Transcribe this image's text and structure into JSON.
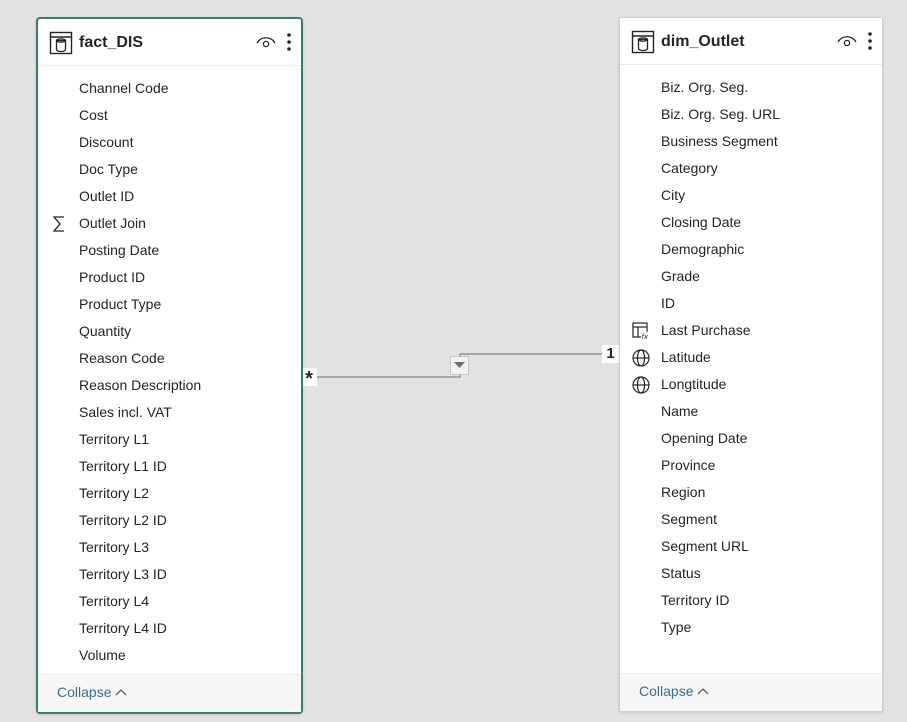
{
  "relationship": {
    "from_cardinality": "*",
    "to_cardinality": "1"
  },
  "fact_table": {
    "name": "fact_DIS",
    "collapse_label": "Collapse",
    "fields": [
      {
        "label": "Channel Code",
        "icon": ""
      },
      {
        "label": "Cost",
        "icon": ""
      },
      {
        "label": "Discount",
        "icon": ""
      },
      {
        "label": "Doc Type",
        "icon": ""
      },
      {
        "label": "Outlet ID",
        "icon": ""
      },
      {
        "label": "Outlet Join",
        "icon": "sigma-icon"
      },
      {
        "label": "Posting Date",
        "icon": ""
      },
      {
        "label": "Product ID",
        "icon": ""
      },
      {
        "label": "Product Type",
        "icon": ""
      },
      {
        "label": "Quantity",
        "icon": ""
      },
      {
        "label": "Reason Code",
        "icon": ""
      },
      {
        "label": "Reason Description",
        "icon": ""
      },
      {
        "label": "Sales incl. VAT",
        "icon": ""
      },
      {
        "label": "Territory L1",
        "icon": ""
      },
      {
        "label": "Territory L1 ID",
        "icon": ""
      },
      {
        "label": "Territory L2",
        "icon": ""
      },
      {
        "label": "Territory L2 ID",
        "icon": ""
      },
      {
        "label": "Territory L3",
        "icon": ""
      },
      {
        "label": "Territory L3 ID",
        "icon": ""
      },
      {
        "label": "Territory L4",
        "icon": ""
      },
      {
        "label": "Territory L4 ID",
        "icon": ""
      },
      {
        "label": "Volume",
        "icon": ""
      }
    ]
  },
  "dim_table": {
    "name": "dim_Outlet",
    "collapse_label": "Collapse",
    "fields": [
      {
        "label": "Biz. Org. Seg.",
        "icon": ""
      },
      {
        "label": "Biz. Org. Seg. URL",
        "icon": ""
      },
      {
        "label": "Business Segment",
        "icon": ""
      },
      {
        "label": "Category",
        "icon": ""
      },
      {
        "label": "City",
        "icon": ""
      },
      {
        "label": "Closing Date",
        "icon": ""
      },
      {
        "label": "Demographic",
        "icon": ""
      },
      {
        "label": "Grade",
        "icon": ""
      },
      {
        "label": "ID",
        "icon": ""
      },
      {
        "label": "Last Purchase",
        "icon": "calculated-column-icon"
      },
      {
        "label": "Latitude",
        "icon": "globe-icon"
      },
      {
        "label": "Longtitude",
        "icon": "globe-icon"
      },
      {
        "label": "Name",
        "icon": ""
      },
      {
        "label": "Opening Date",
        "icon": ""
      },
      {
        "label": "Province",
        "icon": ""
      },
      {
        "label": "Region",
        "icon": ""
      },
      {
        "label": "Segment",
        "icon": ""
      },
      {
        "label": "Segment URL",
        "icon": ""
      },
      {
        "label": "Status",
        "icon": ""
      },
      {
        "label": "Territory ID",
        "icon": ""
      },
      {
        "label": "Type",
        "icon": ""
      }
    ]
  }
}
